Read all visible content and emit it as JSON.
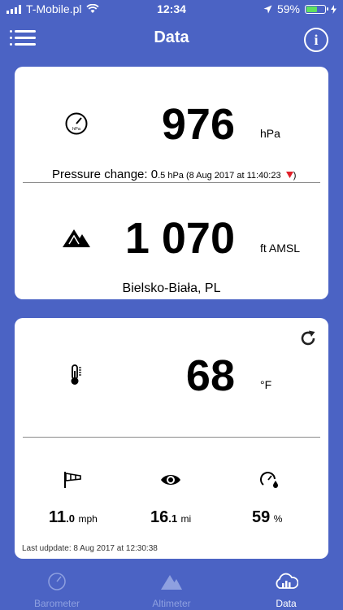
{
  "status": {
    "carrier": "T-Mobile.pl",
    "time": "12:34",
    "battery": "59%",
    "battery_level": 0.59
  },
  "nav": {
    "title": "Data",
    "info": "i"
  },
  "pressure": {
    "value": "976",
    "unit": "hPa",
    "gauge_label": "hPa",
    "change_label": "Pressure change: ",
    "change_whole": "0",
    "change_rest": ".5 hPa (8 Aug 2017 at 11:40:23",
    "change_close": ")"
  },
  "altitude": {
    "value": "1 070",
    "unit": "ft AMSL",
    "location": "Bielsko-Biała, PL"
  },
  "temperature": {
    "value": "68",
    "unit": "°F"
  },
  "wind": {
    "whole": "11",
    "decimal": ".0",
    "unit": "mph"
  },
  "visibility": {
    "whole": "16",
    "decimal": ".1",
    "unit": "mi"
  },
  "humidity": {
    "value": "59",
    "unit": "%"
  },
  "last_update": "Last udpdate: 8 Aug 2017 at 12:30:38",
  "tabs": [
    {
      "label": "Barometer",
      "active": false
    },
    {
      "label": "Altimeter",
      "active": false
    },
    {
      "label": "Data",
      "active": true
    }
  ],
  "colors": {
    "header": "#4b63c4",
    "card": "#ffffff",
    "battery": "#5fe05f",
    "trend_down": "#e0202a"
  }
}
